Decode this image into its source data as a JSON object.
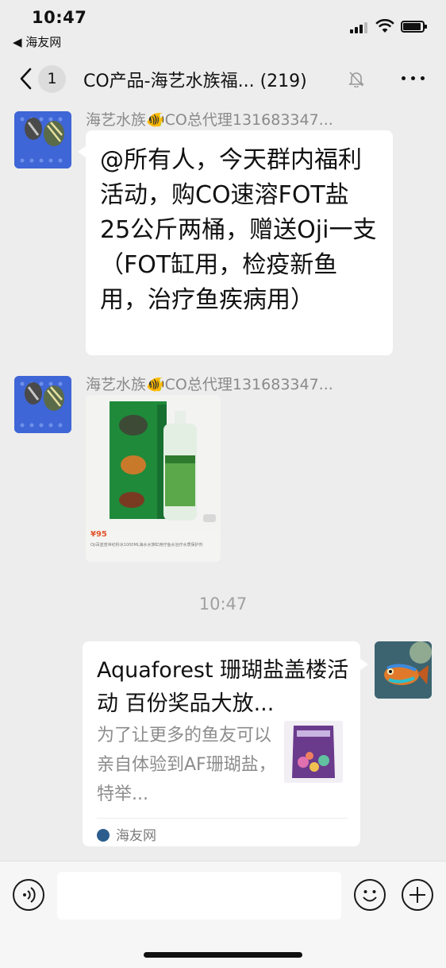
{
  "status_bar": {
    "time": "10:47",
    "back_app": "◀ 海友网"
  },
  "nav": {
    "unread_count": "1",
    "title": "CO产品-海艺水族福... (219)",
    "icons": [
      "back-chevron-icon",
      "mute-bell-icon",
      "more-icon"
    ]
  },
  "messages": [
    {
      "sender": "海艺水族🐠CO总代理131683347...",
      "text": "@所有人，今天群内福利活动，购CO速溶FOT盐25公斤两桶，赠送Oji一支（FOT缸用，检疫新鱼用，治疗鱼疾病用）"
    },
    {
      "sender": "海艺水族🐠CO总代理131683347...",
      "image": {
        "price": "¥95",
        "caption": "Oji百蓝普世纪科冰1000ML海水水族缸用疗鱼水治疗水质保护剂"
      }
    }
  ],
  "timestamp": "10:47",
  "card": {
    "title": "Aquaforest 珊瑚盐盖楼活动 百份奖品大放...",
    "description": "为了让更多的鱼友可以亲自体验到AF珊瑚盐，特举...",
    "source": "海友网"
  },
  "colors": {
    "background": "#ededed",
    "bubble": "#ffffff",
    "muted_text": "#8a8a8a"
  }
}
